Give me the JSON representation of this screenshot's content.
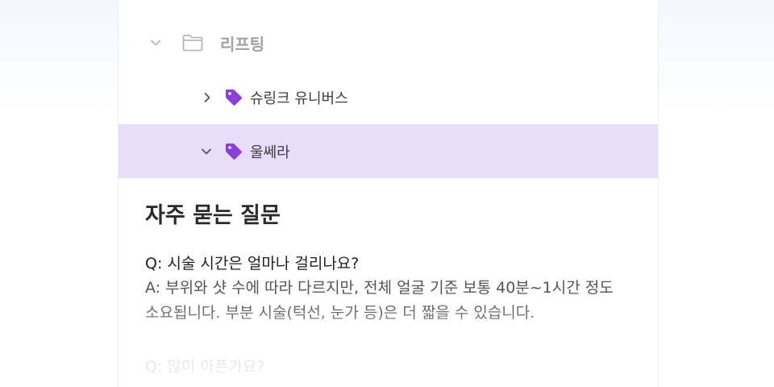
{
  "tree": {
    "folder": {
      "label": "리프팅",
      "icon": "folder-icon",
      "expanded": true
    },
    "items": [
      {
        "label": "슈링크 유니버스",
        "icon": "tag-icon",
        "expanded": false,
        "selected": false
      },
      {
        "label": "울쎄라",
        "icon": "tag-icon",
        "expanded": true,
        "selected": true
      }
    ],
    "tag_color": "#8a3fdc",
    "selected_bg": "#e8defa"
  },
  "faq": {
    "title": "자주 묻는 질문",
    "entries": [
      {
        "question": "Q: 시술 시간은 얼마나 걸리나요?",
        "answer_line1": "A: 부위와 샷 수에 따라 다르지만, 전체 얼굴 기준 보통 40분~1시간 정도",
        "answer_line2": "소요됩니다. 부분 시술(턱선, 눈가 등)은 더 짧을 수 있습니다."
      },
      {
        "question": "Q: 많이 아픈가요?"
      }
    ]
  }
}
